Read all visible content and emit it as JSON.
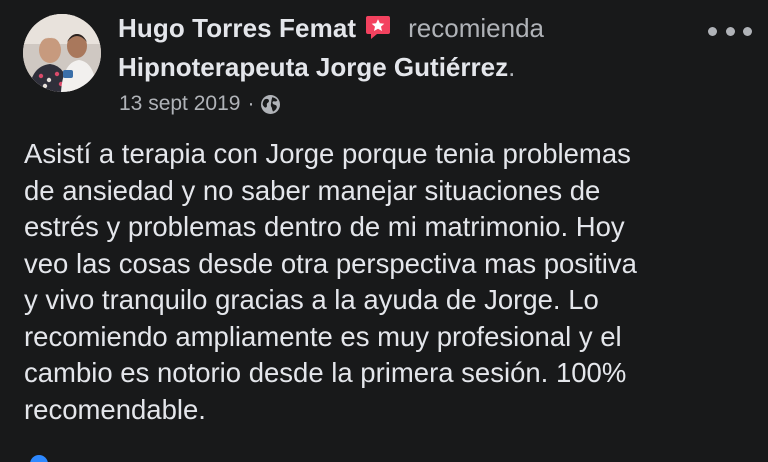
{
  "post": {
    "author": "Hugo Torres Femat",
    "action": "recomienda",
    "page_name": "Hipnoterapeuta Jorge Gutiérrez",
    "page_name_suffix": ".",
    "date": "13 sept 2019",
    "separator": "·",
    "privacy_icon": "globe-icon",
    "recommend_icon": "recommend-badge-icon",
    "more_icon": "more-options-icon",
    "body_lines": [
      "Asistí a terapia con Jorge porque tenia problemas",
      "de ansiedad y no saber manejar situaciones de",
      "estrés y problemas dentro de mi matrimonio. Hoy",
      "veo las cosas desde otra perspectiva mas positiva",
      "y vivo tranquilo gracias a la ayuda de Jorge. Lo",
      "recomiendo ampliamente es muy profesional y el",
      "cambio es notorio desde la primera sesión. 100%",
      "recomendable."
    ]
  },
  "colors": {
    "background": "#18191a",
    "primary_text": "#e4e6eb",
    "secondary_text": "#b0b3b8",
    "recommend_badge": "#f3425f",
    "accent_blue": "#2d88ff"
  }
}
